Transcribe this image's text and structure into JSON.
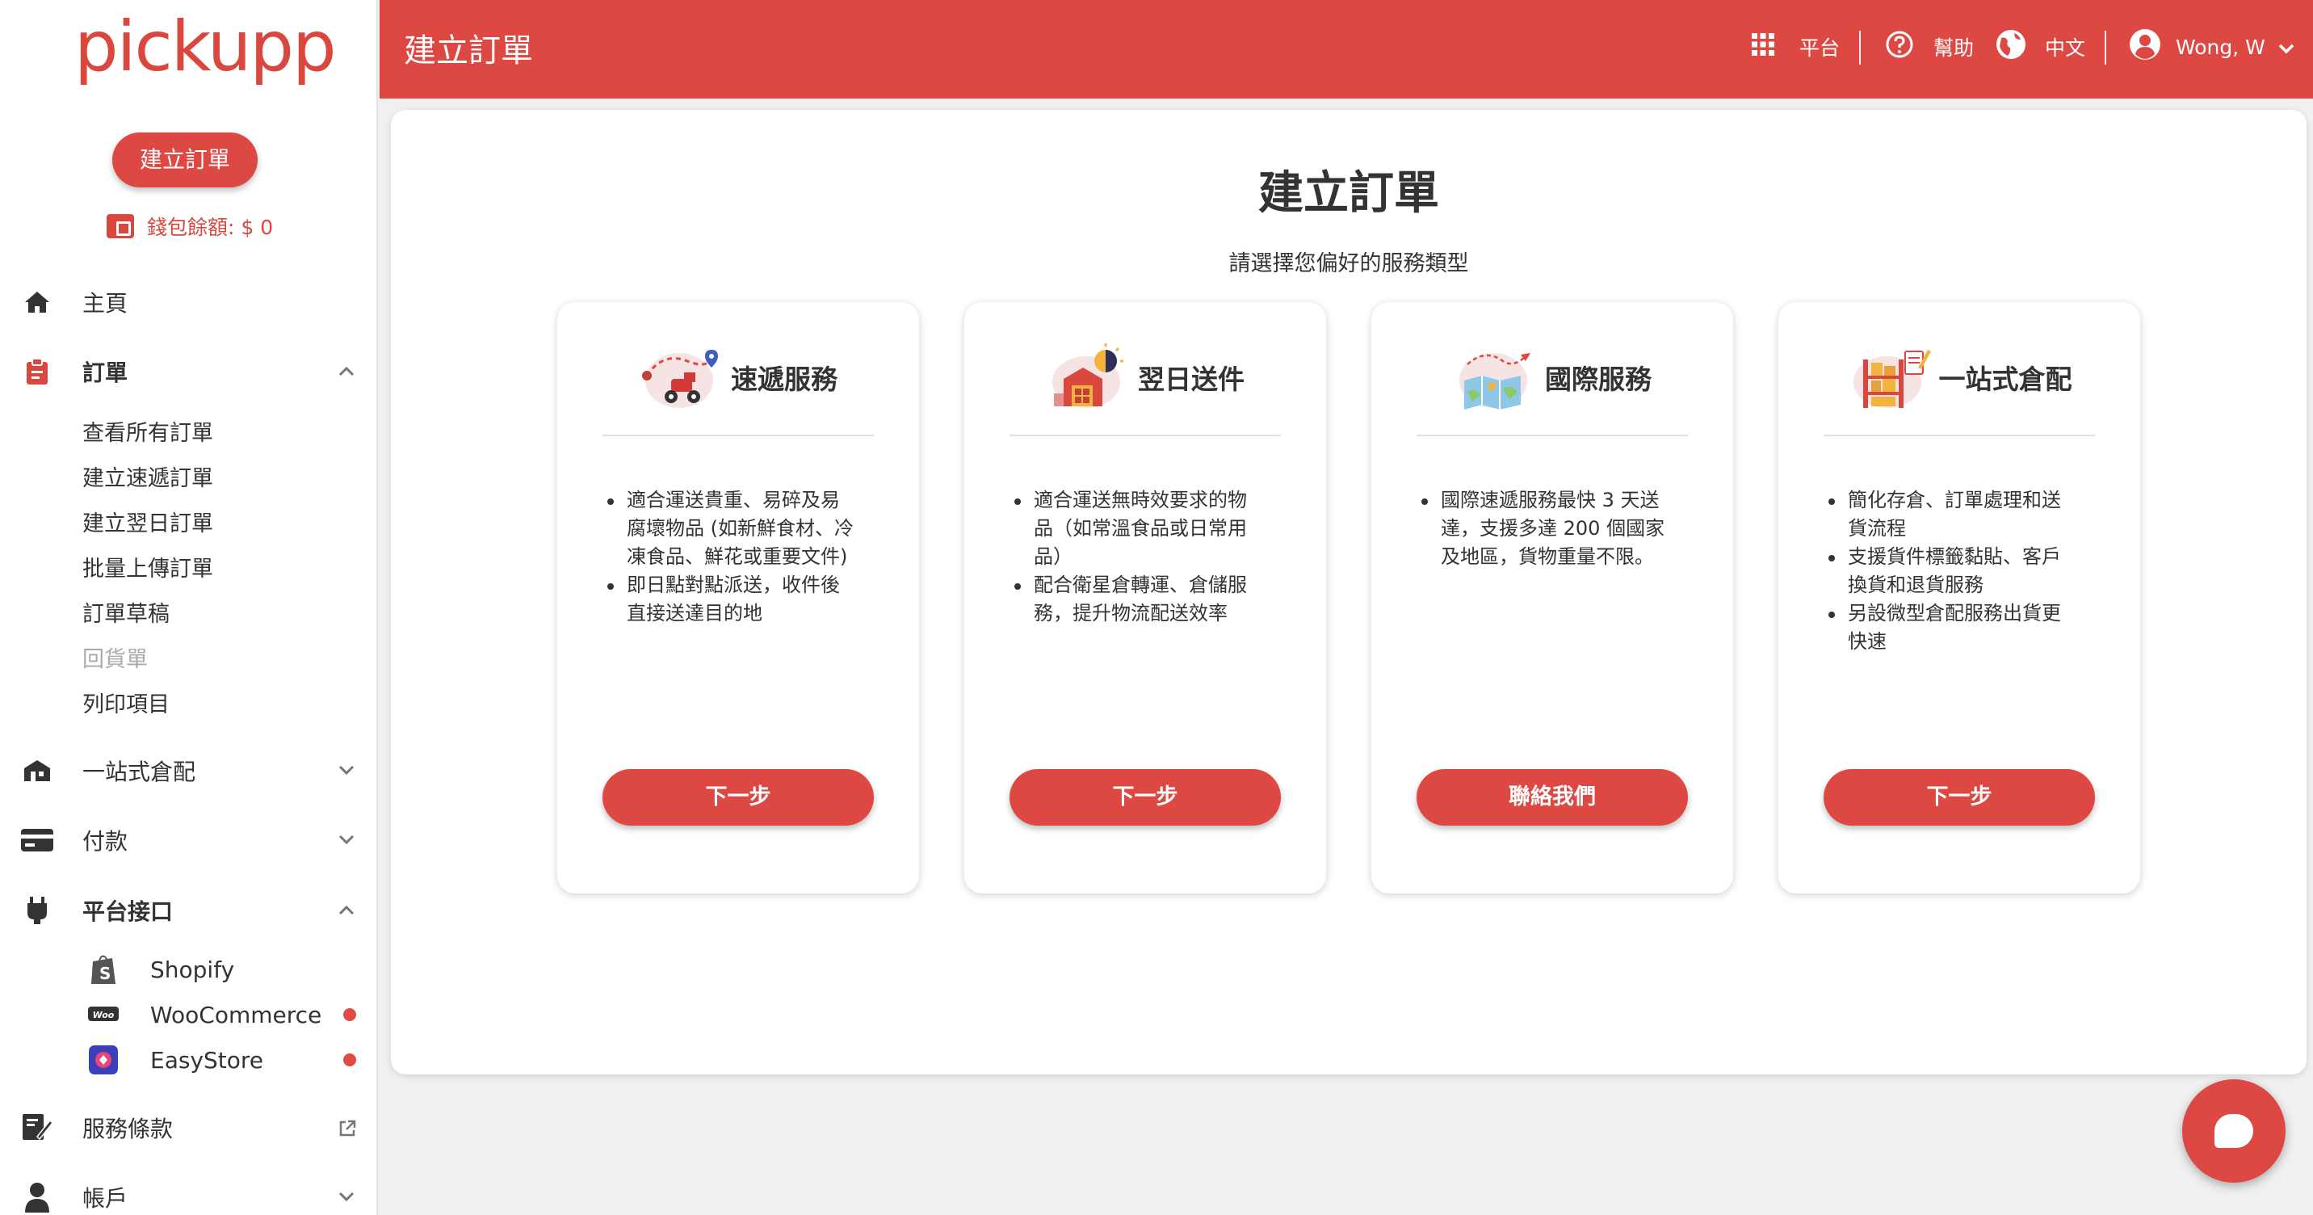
{
  "sidebar": {
    "logo": "pickupp",
    "create_order": "建立訂單",
    "wallet": "錢包餘額: $ 0",
    "nav": {
      "home": "主頁",
      "orders": "訂單",
      "warehouse": "一站式倉配",
      "payment": "付款",
      "platform": "平台接口",
      "terms": "服務條款",
      "account": "帳戶"
    },
    "orders_sub": [
      "查看所有訂單",
      "建立速遞訂單",
      "建立翌日訂單",
      "批量上傳訂單",
      "訂單草稿",
      "回貨單",
      "列印項目"
    ],
    "platforms": [
      "Shopify",
      "WooCommerce",
      "EasyStore"
    ],
    "woo_badge": "Woo"
  },
  "header": {
    "title": "建立訂單",
    "platform": "平台",
    "help": "幫助",
    "language": "中文",
    "user": "Wong, W"
  },
  "main": {
    "title": "建立訂單",
    "subtitle": "請選擇您偏好的服務類型",
    "cards": [
      {
        "title": "速遞服務",
        "bullets": [
          "適合運送貴重、易碎及易腐壞物品 (如新鮮食材、冷凍食品、鮮花或重要文件)",
          "即日點對點派送，收件後直接送達目的地"
        ],
        "button": "下一步",
        "icon": "scooter-icon"
      },
      {
        "title": "翌日送件",
        "bullets": [
          "適合運送無時效要求的物品（如常溫食品或日常用品）",
          "配合衛星倉轉運、倉儲服務，提升物流配送效率"
        ],
        "button": "下一步",
        "icon": "sun-warehouse-icon"
      },
      {
        "title": "國際服務",
        "bullets": [
          "國際速遞服務最快 3 天送達，支援多達 200 個國家及地區，貨物重量不限。"
        ],
        "button": "聯絡我們",
        "icon": "map-plane-icon"
      },
      {
        "title": "一站式倉配",
        "bullets": [
          "簡化存倉、訂單處理和送貨流程",
          "支援貨件標籤黏貼、客戶換貨和退貨服務",
          "另設微型倉配服務出貨更快速"
        ],
        "button": "下一步",
        "icon": "shelf-icon"
      }
    ]
  },
  "colors": {
    "brand": "#dd4942",
    "text": "#333333",
    "background": "#f0f0f0"
  }
}
